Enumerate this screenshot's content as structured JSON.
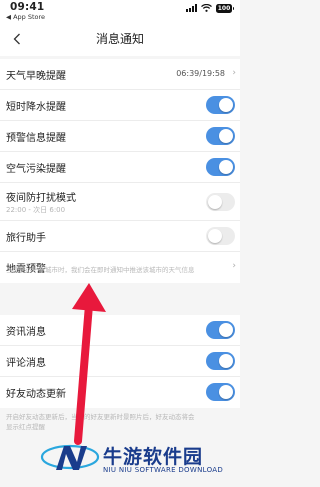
{
  "status_bar": {
    "time": "09:41",
    "back_app": "◀ App Store",
    "battery": "100",
    "icons": [
      "signal-icon",
      "wifi-icon",
      "battery-icon"
    ]
  },
  "nav": {
    "title": "消息通知",
    "back_icon": "chevron-left-icon"
  },
  "settings": {
    "daily_forecast": {
      "label": "天气早晚提醒",
      "value": "06:39/19:58"
    },
    "short_rain": {
      "label": "短时降水提醒",
      "on": true
    },
    "warning": {
      "label": "预警信息提醒",
      "on": true
    },
    "air_pollution": {
      "label": "空气污染提醒",
      "on": true
    },
    "night_dnd": {
      "label": "夜间防打扰模式",
      "sub": "22:00 - 次日 6:00",
      "on": false
    },
    "travel_assistant": {
      "label": "旅行助手",
      "on": false
    },
    "earthquake": {
      "label": "地震预警"
    }
  },
  "note1": "当您到达一个城市时，我们会在即时通知中推送该城市的天气信息",
  "social": {
    "news": {
      "label": "资讯消息",
      "on": true
    },
    "comments": {
      "label": "评论消息",
      "on": true
    },
    "friends": {
      "label": "好友动态更新",
      "on": true
    }
  },
  "note2": {
    "line1": "开启好友动态更新后，当您的好友更新时景照片后，好友动态将会",
    "line2": "显示红点提醒"
  },
  "watermark": {
    "cn": "牛游软件园",
    "en": "NIU NIU SOFTWARE DOWNLOAD"
  },
  "colors": {
    "toggle_on": "#4a90e2",
    "toggle_off": "#ececec",
    "annotation_arrow": "#e8193c",
    "watermark": "#1a3c8c"
  }
}
